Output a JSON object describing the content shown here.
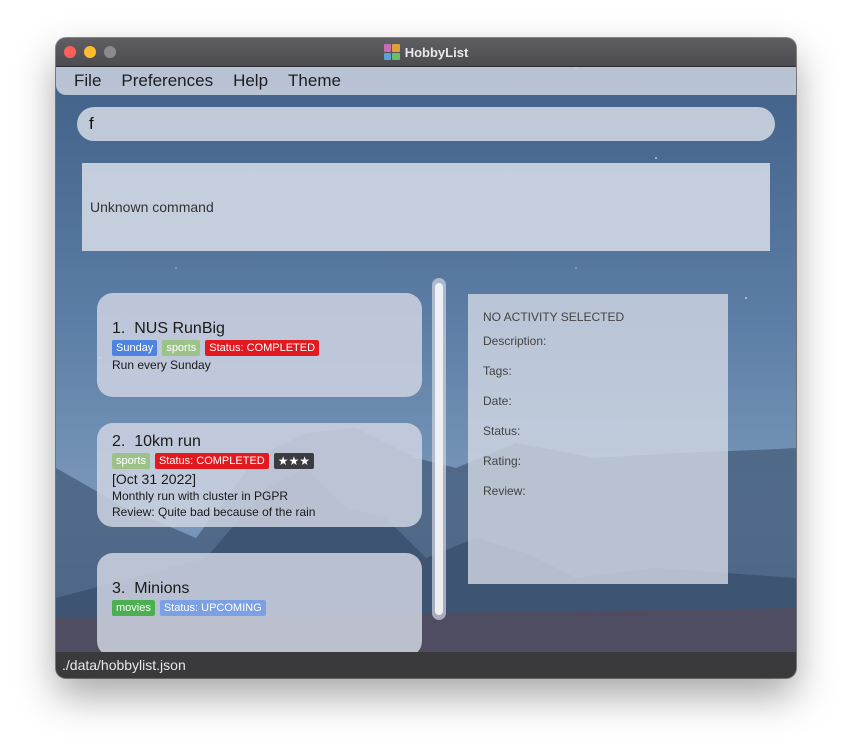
{
  "window": {
    "title": "HobbyList"
  },
  "menu": {
    "items": [
      "File",
      "Preferences",
      "Help",
      "Theme"
    ]
  },
  "command": {
    "value": "f"
  },
  "result": {
    "text": "Unknown command"
  },
  "activities": [
    {
      "index": "1.",
      "name": "NUS RunBig",
      "tags": [
        {
          "text": "Sunday",
          "color": "#4f83e0"
        },
        {
          "text": "sports",
          "color": "#9cc28a"
        },
        {
          "text": "Status: COMPLETED",
          "color": "#e21a1f"
        }
      ],
      "date": "",
      "description": "Run every Sunday",
      "review": ""
    },
    {
      "index": "2.",
      "name": "10km run",
      "tags": [
        {
          "text": "sports",
          "color": "#9cc28a"
        },
        {
          "text": "Status: COMPLETED",
          "color": "#e21a1f"
        },
        {
          "text": "★★★",
          "color": "#3c3c40"
        }
      ],
      "date": "[Oct 31 2022]",
      "description": "Monthly run with cluster in PGPR",
      "review": "Review: Quite bad because of the rain"
    },
    {
      "index": "3.",
      "name": "Minions",
      "tags": [
        {
          "text": "movies",
          "color": "#4caf50"
        },
        {
          "text": "Status: UPCOMING",
          "color": "#7ca0e4"
        }
      ],
      "date": "",
      "description": "",
      "review": ""
    }
  ],
  "detail": {
    "header": "NO ACTIVITY SELECTED",
    "fields": [
      "Description:",
      "Tags:",
      "Date:",
      "Status:",
      "Rating:",
      "Review:"
    ]
  },
  "statusbar": {
    "path": "./data/hobbylist.json"
  },
  "colors": {
    "titlebar": "#5a5a5e",
    "close": "#fe5f57",
    "minimize": "#febc2e",
    "statusbar": "#3a3a3d"
  }
}
